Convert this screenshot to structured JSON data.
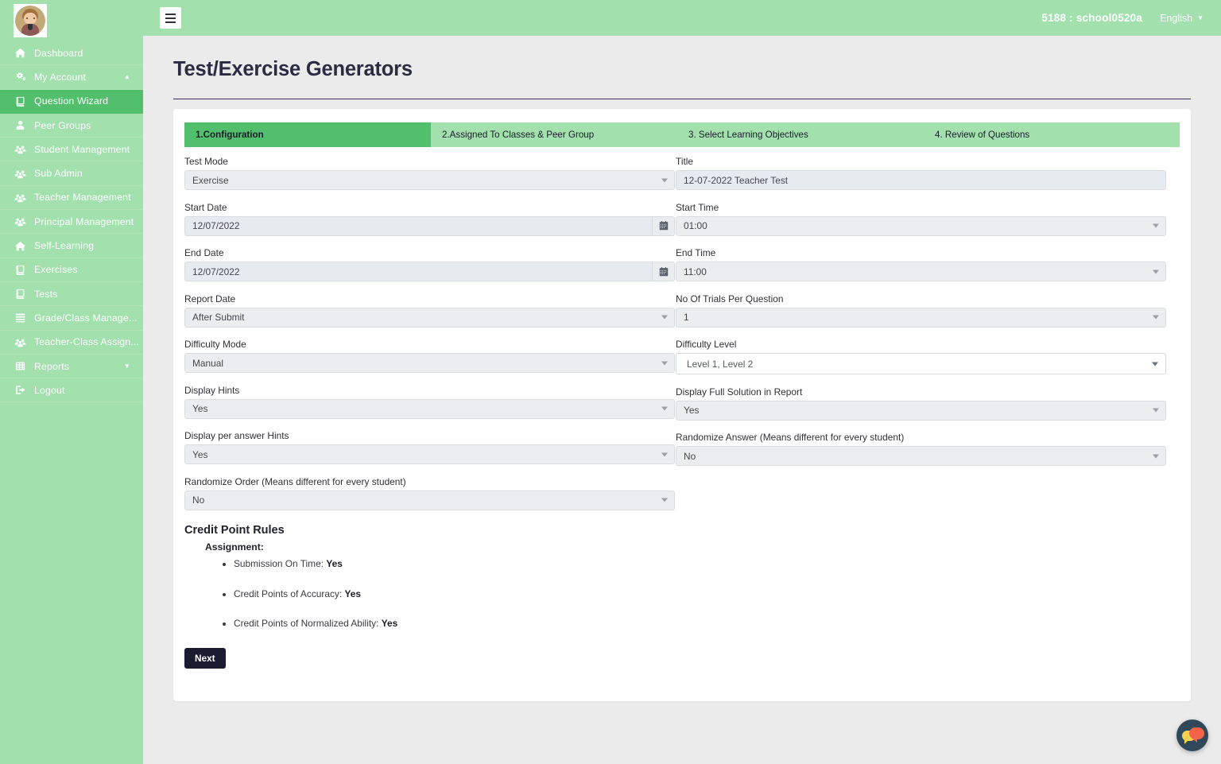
{
  "sidebar": {
    "avatar_alt": "user-avatar",
    "items": [
      {
        "label": "Dashboard",
        "icon": "home-icon",
        "active": false,
        "caret": ""
      },
      {
        "label": "My Account",
        "icon": "gears-icon",
        "active": false,
        "caret": "▲"
      },
      {
        "label": "Question Wizard",
        "icon": "book-icon",
        "active": true,
        "caret": ""
      },
      {
        "label": "Peer Groups",
        "icon": "user-icon",
        "active": false,
        "caret": ""
      },
      {
        "label": "Student Management",
        "icon": "users-icon",
        "active": false,
        "caret": ""
      },
      {
        "label": "Sub Admin",
        "icon": "users-icon",
        "active": false,
        "caret": ""
      },
      {
        "label": "Teacher Management",
        "icon": "users-icon",
        "active": false,
        "caret": ""
      },
      {
        "label": "Principal Management",
        "icon": "users-icon",
        "active": false,
        "caret": ""
      },
      {
        "label": "Self-Learning",
        "icon": "home-icon",
        "active": false,
        "caret": ""
      },
      {
        "label": "Exercises",
        "icon": "book-icon",
        "active": false,
        "caret": ""
      },
      {
        "label": "Tests",
        "icon": "book-icon",
        "active": false,
        "caret": ""
      },
      {
        "label": "Grade/Class Manage...",
        "icon": "list-icon",
        "active": false,
        "caret": ""
      },
      {
        "label": "Teacher-Class Assign...",
        "icon": "users-icon",
        "active": false,
        "caret": ""
      },
      {
        "label": "Reports",
        "icon": "table-icon",
        "active": false,
        "caret": "▼"
      },
      {
        "label": "Logout",
        "icon": "logout-icon",
        "active": false,
        "caret": ""
      }
    ]
  },
  "topbar": {
    "menu_toggle": "hamburger-icon",
    "school_id": "5188 : school0520a",
    "language": "English"
  },
  "page": {
    "title": "Test/Exercise Generators"
  },
  "tabs": [
    {
      "label": "1.Configuration",
      "active": true
    },
    {
      "label": "2.Assigned To Classes & Peer Group",
      "active": false
    },
    {
      "label": "3. Select Learning Objectives",
      "active": false
    },
    {
      "label": "4. Review of Questions",
      "active": false
    }
  ],
  "form": {
    "test_mode": {
      "label": "Test Mode",
      "value": "Exercise"
    },
    "title": {
      "label": "Title",
      "value": "12-07-2022 Teacher Test",
      "placeholder": ""
    },
    "start_date": {
      "label": "Start Date",
      "value": "12/07/2022"
    },
    "start_time": {
      "label": "Start Time",
      "value": "01:00"
    },
    "end_date": {
      "label": "End Date",
      "value": "12/07/2022"
    },
    "end_time": {
      "label": "End Time",
      "value": "11:00"
    },
    "report_date": {
      "label": "Report Date",
      "value": "After Submit"
    },
    "trials": {
      "label": "No Of Trials Per Question",
      "value": "1"
    },
    "difficulty_mode": {
      "label": "Difficulty Mode",
      "value": "Manual"
    },
    "difficulty_level": {
      "label": "Difficulty Level",
      "value": "Level 1, Level 2"
    },
    "display_hints": {
      "label": "Display Hints",
      "value": "Yes"
    },
    "display_full_solution": {
      "label": "Display Full Solution in Report",
      "value": "Yes"
    },
    "display_per_answer_hints": {
      "label": "Display per answer Hints",
      "value": "Yes"
    },
    "randomize_answer": {
      "label": "Randomize Answer (Means different for every student)",
      "value": "No"
    },
    "randomize_order": {
      "label": "Randomize Order (Means different for every student)",
      "value": "No"
    }
  },
  "credit_rules": {
    "heading": "Credit Point Rules",
    "subheading": "Assignment:",
    "items": [
      {
        "text": "Submission On Time: ",
        "value": "Yes"
      },
      {
        "text": "Credit Points of Accuracy: ",
        "value": "Yes"
      },
      {
        "text": "Credit Points of Normalized Ability: ",
        "value": "Yes"
      }
    ]
  },
  "actions": {
    "next_label": "Next"
  },
  "chat": {
    "icon": "chat-bubbles-icon"
  },
  "colors": {
    "sidebar_bg": "#a2e0ae",
    "sidebar_active": "#52bf6d",
    "topbar_bg": "#a2e0ae",
    "content_bg": "#ebebeb",
    "card_bg": "#ffffff",
    "title_text": "#2b2b42",
    "rule": "#3b2a63",
    "button_dark": "#1b1b32",
    "input_bg": "#ebedef",
    "chat_bg": "#31475a"
  }
}
